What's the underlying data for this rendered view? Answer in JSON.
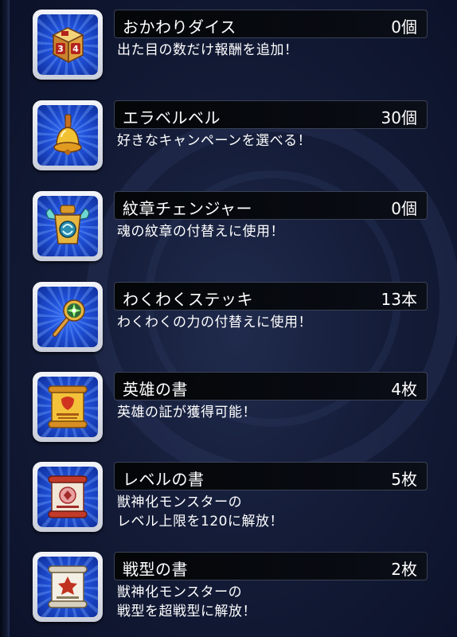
{
  "items": [
    {
      "name": "おかわりダイス",
      "count": "0個",
      "desc": [
        "出た目の数だけ報酬を追加！"
      ],
      "icon": "dice-icon"
    },
    {
      "name": "エラベルベル",
      "count": "30個",
      "desc": [
        "好きなキャンペーンを選べる！"
      ],
      "icon": "bell-icon"
    },
    {
      "name": "紋章チェンジャー",
      "count": "0個",
      "desc": [
        "魂の紋章の付替えに使用！"
      ],
      "icon": "emblem-changer-icon"
    },
    {
      "name": "わくわくステッキ",
      "count": "13本",
      "desc": [
        "わくわくの力の付替えに使用！"
      ],
      "icon": "magic-stick-icon"
    },
    {
      "name": "英雄の書",
      "count": "4枚",
      "desc": [
        "英雄の証が獲得可能！"
      ],
      "icon": "hero-scroll-icon"
    },
    {
      "name": "レベルの書",
      "count": "5枚",
      "desc": [
        "獣神化モンスターの",
        "レベル上限を120に解放！"
      ],
      "icon": "level-scroll-icon"
    },
    {
      "name": "戦型の書",
      "count": "2枚",
      "desc": [
        "獣神化モンスターの",
        "戦型を超戦型に解放！"
      ],
      "icon": "battle-type-scroll-icon"
    }
  ]
}
